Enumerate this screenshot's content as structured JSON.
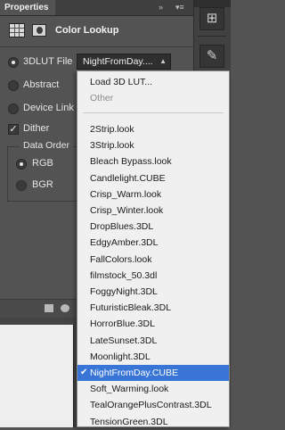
{
  "panel": {
    "tab_label": "Properties",
    "title": "Color Lookup",
    "tab_controls": {
      "collapse": "»",
      "menu": "▾≡"
    }
  },
  "options": {
    "lut_file_label": "3DLUT File",
    "lut_file_value": "NightFromDay....",
    "abstract_label": "Abstract",
    "device_link_label": "Device Link",
    "dither_label": "Dither",
    "dither_checked": true,
    "data_order": {
      "title": "Data Order",
      "rgb_label": "RGB",
      "bgr_label": "BGR",
      "selected": "RGB"
    }
  },
  "menu": {
    "header_items": [
      "Load 3D LUT...",
      "Other"
    ],
    "items": [
      "2Strip.look",
      "3Strip.look",
      "Bleach Bypass.look",
      "Candlelight.CUBE",
      "Crisp_Warm.look",
      "Crisp_Winter.look",
      "DropBlues.3DL",
      "EdgyAmber.3DL",
      "FallColors.look",
      "filmstock_50.3dl",
      "FoggyNight.3DL",
      "FuturisticBleak.3DL",
      "HorrorBlue.3DL",
      "LateSunset.3DL",
      "Moonlight.3DL",
      "NightFromDay.CUBE",
      "Soft_Warming.look",
      "TealOrangePlusContrast.3DL",
      "TensionGreen.3DL"
    ],
    "selected_item": "NightFromDay.CUBE",
    "check_glyph": "✔"
  },
  "dock": {
    "icons": [
      "adjustments-panel-icon",
      "brush-tool-icon"
    ]
  },
  "colors": {
    "panel_bg": "#535353",
    "menu_bg": "#f0f0f0",
    "menu_highlight": "#3875d7"
  }
}
